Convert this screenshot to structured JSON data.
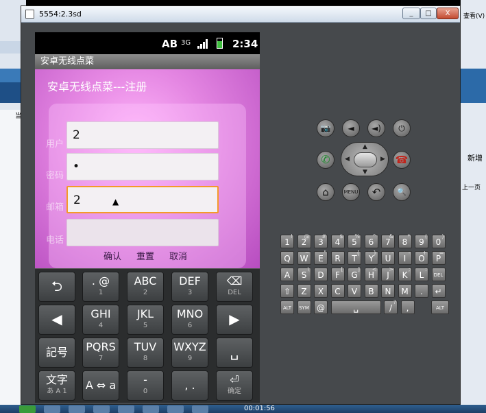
{
  "window": {
    "title": "5554:2.3sd",
    "min": "_",
    "max": "□",
    "close": "X"
  },
  "status_bar": {
    "ab": "AB",
    "network": "3G",
    "time": "2:34"
  },
  "app": {
    "title_bar": "安卓无线点菜",
    "heading": "安卓无线点菜---注册"
  },
  "form": {
    "labels": [
      "用户",
      "密码",
      "邮箱",
      "电话"
    ],
    "values": [
      "2",
      "•",
      "2",
      ""
    ],
    "buttons": [
      "确认",
      "重置",
      "取消"
    ]
  },
  "keyboard": {
    "keys": [
      {
        "main": "⮌",
        "sub": ""
      },
      {
        "main": ". @",
        "sub": "1"
      },
      {
        "main": "ABC",
        "sub": "2"
      },
      {
        "main": "DEF",
        "sub": "3"
      },
      {
        "main": "⌫",
        "sub": "DEL"
      },
      {
        "main": "◀",
        "sub": ""
      },
      {
        "main": "GHI",
        "sub": "4"
      },
      {
        "main": "JKL",
        "sub": "5"
      },
      {
        "main": "MNO",
        "sub": "6"
      },
      {
        "main": "▶",
        "sub": ""
      },
      {
        "main": "記号",
        "sub": ""
      },
      {
        "main": "PQRS",
        "sub": "7"
      },
      {
        "main": "TUV",
        "sub": "8"
      },
      {
        "main": "WXYZ",
        "sub": "9"
      },
      {
        "main": "␣",
        "sub": ""
      },
      {
        "main": "文字",
        "sub": "あ A 1"
      },
      {
        "main": "A ⇔ a",
        "sub": ""
      },
      {
        "main": "-",
        "sub": "0"
      },
      {
        "main": ", .",
        "sub": ""
      },
      {
        "main": "⏎",
        "sub": "确定"
      }
    ]
  },
  "controls": {
    "camera": "📷",
    "vol_down": "◄",
    "vol_up": "◄)",
    "power": "⏻",
    "call": "✆",
    "end_call": "☎",
    "home": "⌂",
    "menu": "MENU",
    "back": "↶",
    "search": "🔍"
  },
  "mini_keyboard": {
    "rows": [
      [
        {
          "k": "1",
          "s": "!"
        },
        {
          "k": "2",
          "s": "@"
        },
        {
          "k": "3",
          "s": "#"
        },
        {
          "k": "4",
          "s": "$"
        },
        {
          "k": "5",
          "s": "%"
        },
        {
          "k": "6",
          "s": "^"
        },
        {
          "k": "7",
          "s": "&"
        },
        {
          "k": "8",
          "s": "*"
        },
        {
          "k": "9",
          "s": "("
        },
        {
          "k": "0",
          "s": ")"
        }
      ],
      [
        {
          "k": "Q",
          "s": ""
        },
        {
          "k": "W",
          "s": "~"
        },
        {
          "k": "E",
          "s": "\""
        },
        {
          "k": "R",
          "s": ""
        },
        {
          "k": "T",
          "s": "{"
        },
        {
          "k": "Y",
          "s": "}"
        },
        {
          "k": "U",
          "s": "-"
        },
        {
          "k": "I",
          "s": "-"
        },
        {
          "k": "O",
          "s": "+"
        },
        {
          "k": "P",
          "s": "="
        }
      ],
      [
        {
          "k": "A",
          "s": ""
        },
        {
          "k": "S",
          "s": "\\"
        },
        {
          "k": "D",
          "s": ""
        },
        {
          "k": "F",
          "s": "["
        },
        {
          "k": "G",
          "s": "]"
        },
        {
          "k": "H",
          "s": "<"
        },
        {
          "k": "J",
          "s": ">"
        },
        {
          "k": "K",
          "s": ";"
        },
        {
          "k": "L",
          "s": ":"
        },
        {
          "k": "DEL",
          "s": ""
        }
      ],
      [
        {
          "k": "⇧",
          "s": ""
        },
        {
          "k": "Z",
          "s": ""
        },
        {
          "k": "X",
          "s": ""
        },
        {
          "k": "C",
          "s": ""
        },
        {
          "k": "V",
          "s": ""
        },
        {
          "k": "B",
          "s": ""
        },
        {
          "k": "N",
          "s": ""
        },
        {
          "k": "M",
          "s": ""
        },
        {
          "k": ".",
          "s": ""
        },
        {
          "k": "↵",
          "s": ""
        }
      ],
      [
        {
          "k": "ALT",
          "s": ""
        },
        {
          "k": "SYM",
          "s": ""
        },
        {
          "k": "@",
          "s": ""
        },
        {
          "k": "␣",
          "s": ""
        },
        {
          "k": "/",
          "s": "?"
        },
        {
          "k": ",",
          "s": ""
        },
        {
          "k": "ALT",
          "s": ""
        }
      ]
    ]
  },
  "desktop": {
    "right_text_1": "查看(V)",
    "right_text_2": "新增",
    "right_text_3": "上一页",
    "left_char": "当",
    "taskbar_time": "00:01:56"
  }
}
